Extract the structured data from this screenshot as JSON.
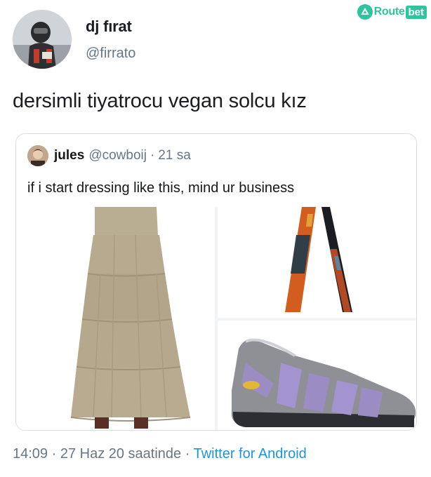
{
  "watermark": {
    "brand": "Route",
    "suffix": "bet",
    "color": "#2ec4a0"
  },
  "tweet": {
    "display_name": "dj fırat",
    "handle": "@firrato",
    "text": "dersimli tiyatrocu vegan solcu kız",
    "timestamp": "14:09 · 27 Haz 20 saatinde",
    "separator": " · ",
    "source": "Twitter for Android"
  },
  "quoted": {
    "display_name": "jules",
    "handle": "@cowboij",
    "separator": "·",
    "time": "21 sa",
    "text": "if i start dressing like this, mind ur business",
    "media": [
      {
        "icon": "skirt-image"
      },
      {
        "icon": "strap-image"
      },
      {
        "icon": "sandal-image"
      }
    ]
  },
  "colors": {
    "link": "#1b95e0",
    "muted": "#657786",
    "text": "#14171a",
    "border": "#d9dee2"
  }
}
